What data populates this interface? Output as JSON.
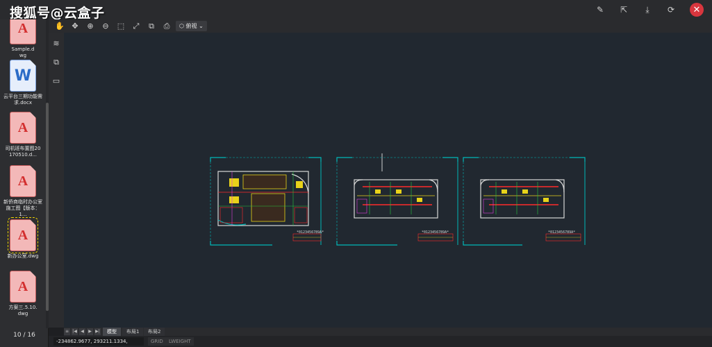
{
  "watermark": "搜狐号@云盒子",
  "top_actions": [
    {
      "name": "edit-icon",
      "glyph": "✎"
    },
    {
      "name": "share-icon",
      "glyph": "⇱"
    },
    {
      "name": "download-icon",
      "glyph": "⤓"
    },
    {
      "name": "refresh-icon",
      "glyph": "⟳"
    },
    {
      "name": "close-icon",
      "glyph": "✕"
    }
  ],
  "files": [
    {
      "type": "cad",
      "badge": "A",
      "name": "Sample.d\nwg"
    },
    {
      "type": "word",
      "badge": "W",
      "name": "云平台三期功能需\n求.docx"
    },
    {
      "type": "cad",
      "badge": "A",
      "name": "司机班布置图20\n170510.d..."
    },
    {
      "type": "cad",
      "badge": "A",
      "name": "新侨商临时办公室\n施工图【版本：1..."
    },
    {
      "type": "cad",
      "badge": "A",
      "name": "新办公室.dwg",
      "selected": true
    },
    {
      "type": "cad",
      "badge": "A",
      "name": "方案三.5.10.\ndwg"
    }
  ],
  "page_counter": "10 / 16",
  "toolbar": {
    "buttons": [
      {
        "name": "pan-hand-icon",
        "glyph": "✋"
      },
      {
        "name": "move-icon",
        "glyph": "✥"
      },
      {
        "name": "zoom-in-icon",
        "glyph": "⊕"
      },
      {
        "name": "zoom-out-icon",
        "glyph": "⊖"
      },
      {
        "name": "zoom-window-icon",
        "glyph": "⬚"
      },
      {
        "name": "fit-extents-icon",
        "glyph": "⤢"
      },
      {
        "name": "compare-icon",
        "glyph": "⧉"
      },
      {
        "name": "print-icon",
        "glyph": "⎙"
      }
    ],
    "view_label": "俯视",
    "view_icon": "cube-icon"
  },
  "side_tools": [
    {
      "name": "layers-icon",
      "glyph": "≋"
    },
    {
      "name": "blocks-icon",
      "glyph": "⧉"
    },
    {
      "name": "screen-icon",
      "glyph": "▭"
    }
  ],
  "drawing": {
    "sheet_label": "*0123456789A*",
    "colors": {
      "frame": "#00b8b8",
      "wall": "#d8d8d8",
      "red": "#ff2a2a",
      "yellow": "#e8d21a",
      "green": "#27c93f",
      "magenta": "#e040e0"
    }
  },
  "tabs": {
    "nav": [
      "≡",
      "|◀",
      "◀",
      "▶",
      "▶|"
    ],
    "layouts": [
      {
        "label": "模型",
        "active": true
      },
      {
        "label": "布局1"
      },
      {
        "label": "布局2"
      }
    ]
  },
  "status": {
    "coords": "-234862.9677, 293211.1334, 0.0000",
    "toggles": [
      "GRID",
      "LWEIGHT"
    ]
  }
}
